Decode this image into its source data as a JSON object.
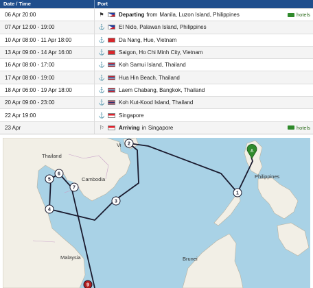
{
  "header": {
    "date_col": "Date / Time",
    "port_col": "Port"
  },
  "rows": [
    {
      "date": "06 Apr 20:00",
      "icon": "flag-icon",
      "flag": "ph",
      "strong": "Departing",
      "rest": "from",
      "port": "Manila, Luzon Island, Philippines",
      "hotels": "hotels"
    },
    {
      "date": "07 Apr 12:00 - 19:00",
      "icon": "anchor-icon",
      "flag": "ph",
      "port": "El Nido, Palawan Island, Philippines"
    },
    {
      "date": "10 Apr 08:00 - 11 Apr 18:00",
      "icon": "anchor-icon",
      "flag": "vn",
      "port": "Da Nang, Hue, Vietnam"
    },
    {
      "date": "13 Apr 09:00 - 14 Apr 16:00",
      "icon": "anchor-icon",
      "flag": "vn",
      "port": "Saigon, Ho Chi Minh City, Vietnam"
    },
    {
      "date": "16 Apr 08:00 - 17:00",
      "icon": "anchor-icon",
      "flag": "th",
      "port": "Koh Samui Island, Thailand"
    },
    {
      "date": "17 Apr 08:00 - 19:00",
      "icon": "anchor-icon",
      "flag": "th",
      "port": "Hua Hin Beach, Thailand"
    },
    {
      "date": "18 Apr 06:00 - 19 Apr 18:00",
      "icon": "anchor-icon",
      "flag": "th",
      "port": "Laem Chabang, Bangkok, Thailand"
    },
    {
      "date": "20 Apr 09:00 - 23:00",
      "icon": "anchor-icon",
      "flag": "th",
      "port": "Koh Kut-Kood Island, Thailand"
    },
    {
      "date": "22 Apr 19:00",
      "icon": "anchor-icon",
      "flag": "sg",
      "port": "Singapore"
    },
    {
      "date": "23 Apr",
      "icon": "finish-flag-icon",
      "flag": "sg",
      "strong": "Arriving",
      "rest": "in",
      "port": "Singapore",
      "hotels": "hotels"
    }
  ],
  "map": {
    "labels": {
      "thailand": "Thailand",
      "cambodia": "Cambodia",
      "philippines": "Philippines",
      "malaysia": "Malaysia",
      "brunei": "Brunei",
      "vietnam_partial": "Vi"
    },
    "markers": [
      "1",
      "2",
      "3",
      "4",
      "5",
      "6",
      "7",
      "9"
    ],
    "colors": {
      "sea": "#a9d2e6",
      "land": "#f2efe6",
      "route": "#1a1a2e",
      "pin": "#2f8a2b"
    }
  }
}
